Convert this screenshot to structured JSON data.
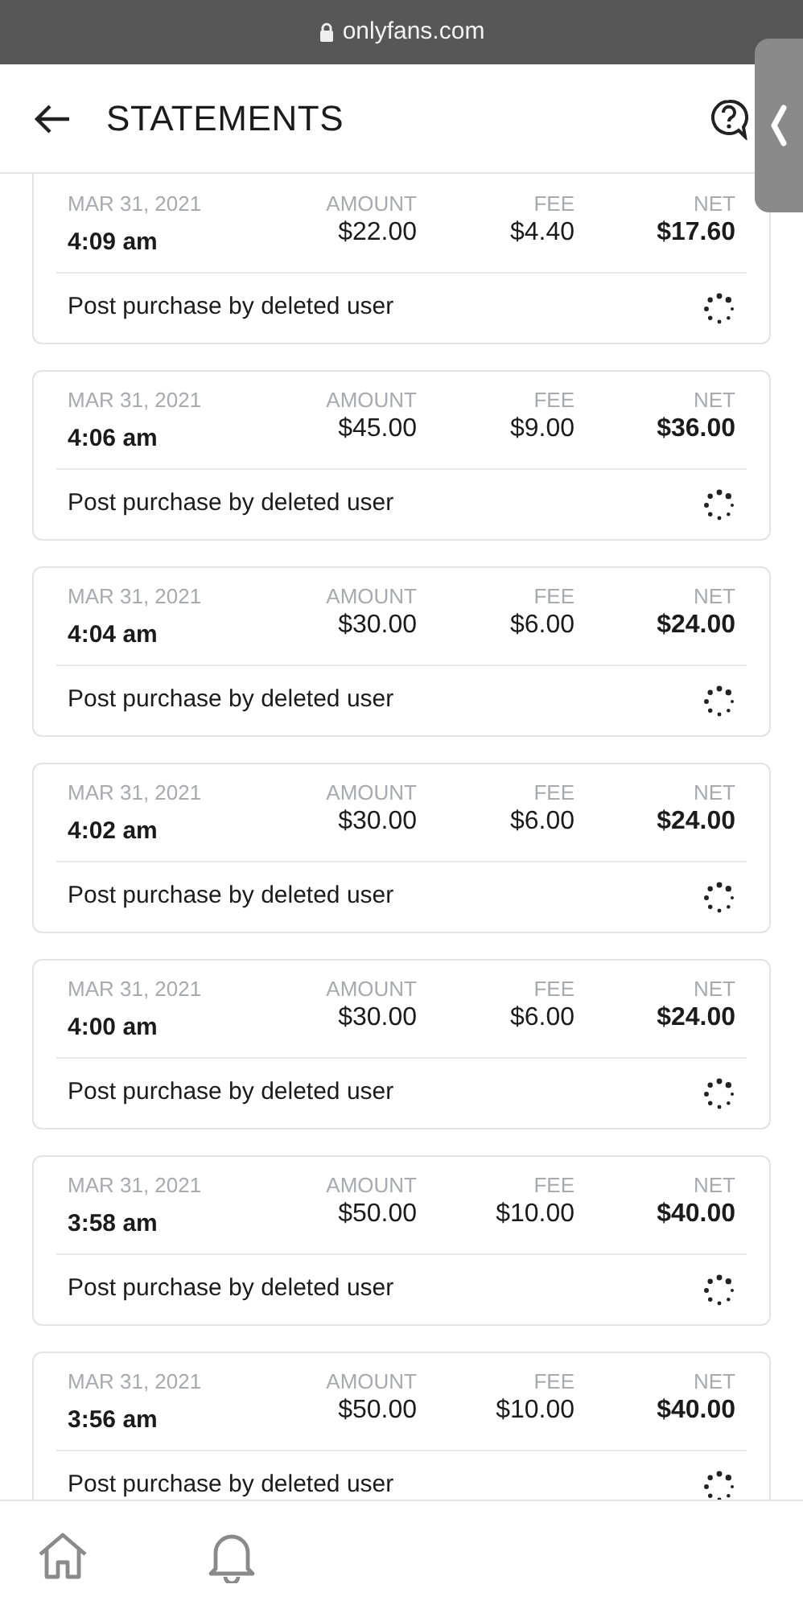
{
  "browser": {
    "url": "onlyfans.com"
  },
  "header": {
    "title": "STATEMENTS"
  },
  "statements": [
    {
      "date": "MAR 31, 2021",
      "time": "4:09 am",
      "amount_label": "AMOUNT",
      "amount": "$22.00",
      "fee_label": "FEE",
      "fee": "$4.40",
      "net_label": "NET",
      "net": "$17.60",
      "description": "Post purchase by deleted user"
    },
    {
      "date": "MAR 31, 2021",
      "time": "4:06 am",
      "amount_label": "AMOUNT",
      "amount": "$45.00",
      "fee_label": "FEE",
      "fee": "$9.00",
      "net_label": "NET",
      "net": "$36.00",
      "description": "Post purchase by deleted user"
    },
    {
      "date": "MAR 31, 2021",
      "time": "4:04 am",
      "amount_label": "AMOUNT",
      "amount": "$30.00",
      "fee_label": "FEE",
      "fee": "$6.00",
      "net_label": "NET",
      "net": "$24.00",
      "description": "Post purchase by deleted user"
    },
    {
      "date": "MAR 31, 2021",
      "time": "4:02 am",
      "amount_label": "AMOUNT",
      "amount": "$30.00",
      "fee_label": "FEE",
      "fee": "$6.00",
      "net_label": "NET",
      "net": "$24.00",
      "description": "Post purchase by deleted user"
    },
    {
      "date": "MAR 31, 2021",
      "time": "4:00 am",
      "amount_label": "AMOUNT",
      "amount": "$30.00",
      "fee_label": "FEE",
      "fee": "$6.00",
      "net_label": "NET",
      "net": "$24.00",
      "description": "Post purchase by deleted user"
    },
    {
      "date": "MAR 31, 2021",
      "time": "3:58 am",
      "amount_label": "AMOUNT",
      "amount": "$50.00",
      "fee_label": "FEE",
      "fee": "$10.00",
      "net_label": "NET",
      "net": "$40.00",
      "description": "Post purchase by deleted user"
    },
    {
      "date": "MAR 31, 2021",
      "time": "3:56 am",
      "amount_label": "AMOUNT",
      "amount": "$50.00",
      "fee_label": "FEE",
      "fee": "$10.00",
      "net_label": "NET",
      "net": "$40.00",
      "description": "Post purchase by deleted user"
    }
  ]
}
